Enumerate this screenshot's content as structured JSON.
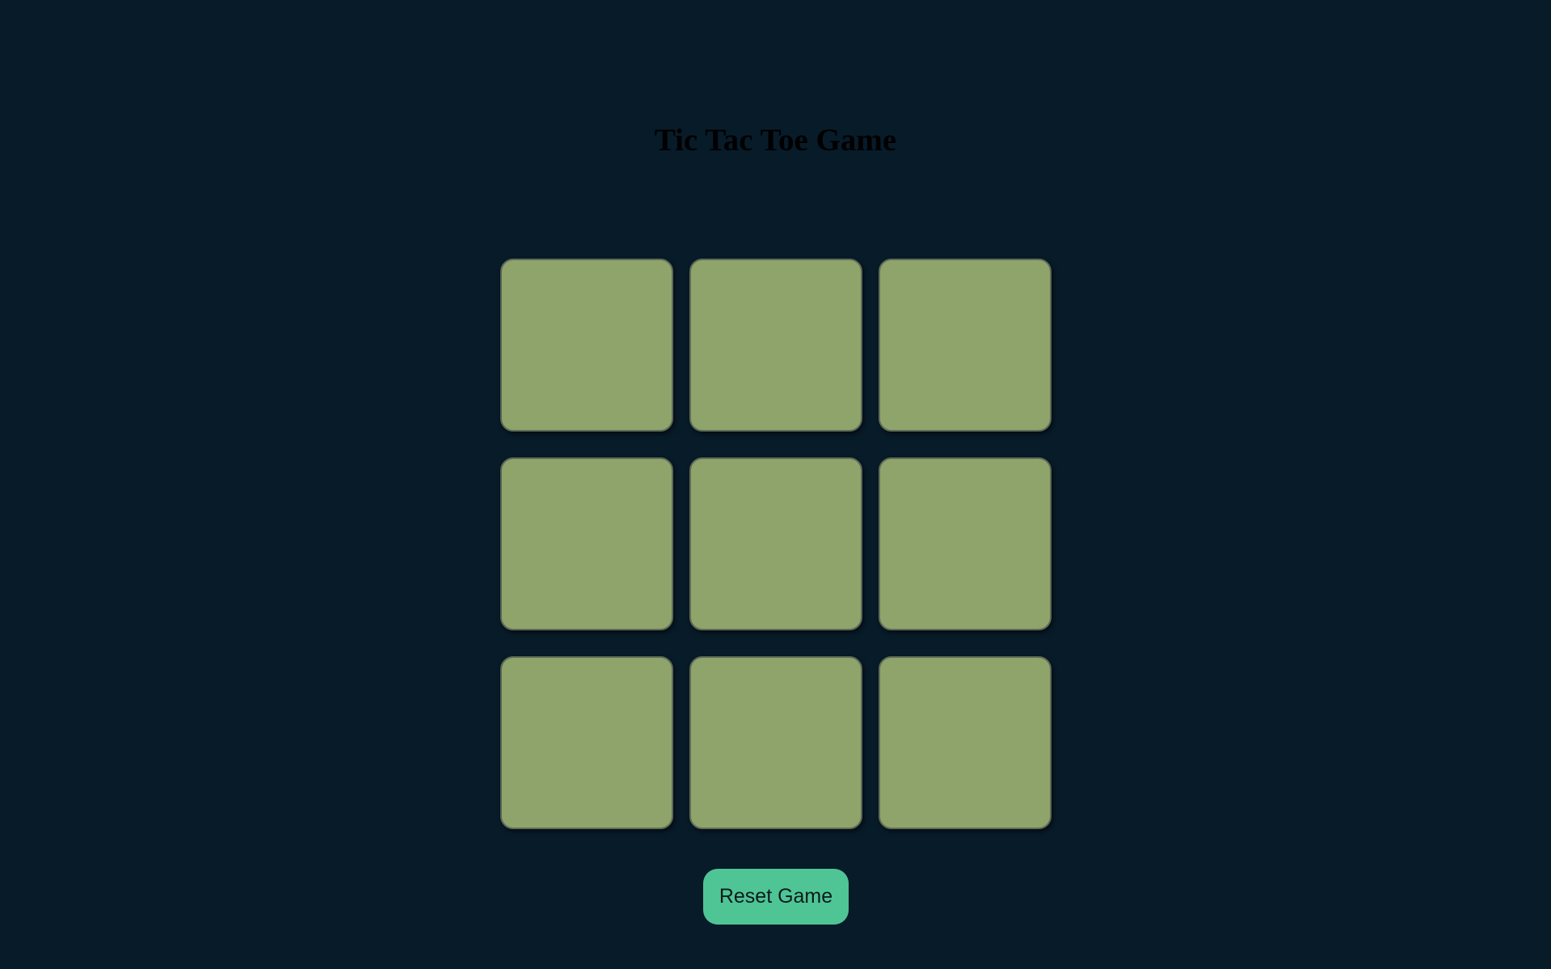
{
  "title": "Tic Tac Toe Game",
  "board": {
    "cells": [
      "",
      "",
      "",
      "",
      "",
      "",
      "",
      "",
      ""
    ]
  },
  "controls": {
    "reset_label": "Reset Game"
  },
  "colors": {
    "background": "#081b29",
    "cell": "#8fa46a",
    "button": "#4fc595"
  }
}
